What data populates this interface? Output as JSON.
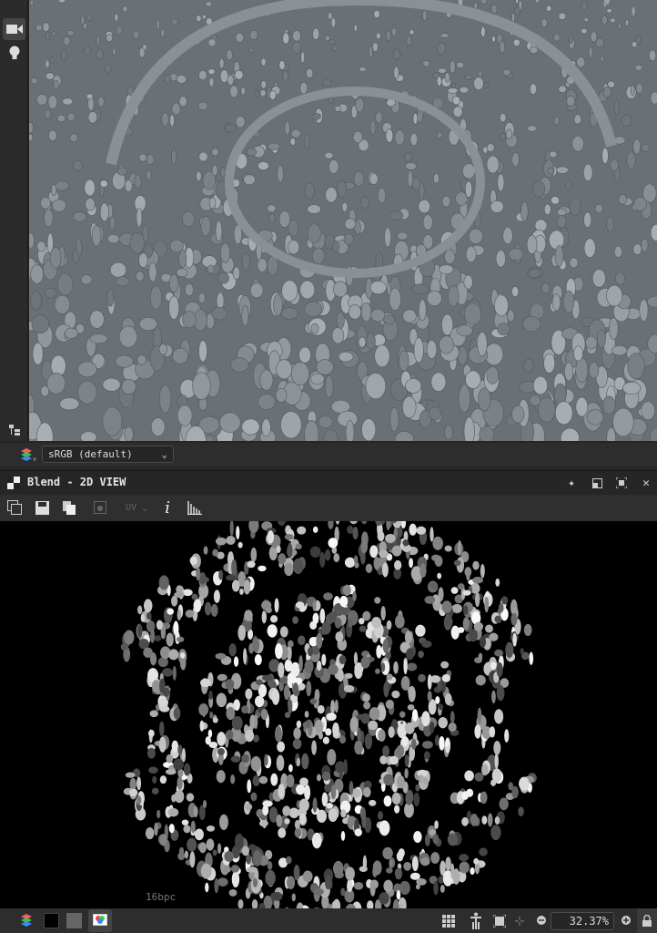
{
  "left_toolbar": {
    "items": [
      {
        "icon": "camera-icon"
      },
      {
        "icon": "lightbulb-icon"
      },
      {
        "icon": "scene-tree-icon"
      }
    ]
  },
  "view3d": {
    "content": "cobblestone pebble floor 3D preview"
  },
  "color_bar": {
    "colorspace": "sRGB (default)"
  },
  "panel": {
    "title": "Blend - 2D VIEW"
  },
  "toolbar2d": {
    "uv_label": "UV",
    "info_label": "i"
  },
  "view2d": {
    "bit_depth": "16bpc"
  },
  "status_bar": {
    "zoom": "32.37%"
  }
}
